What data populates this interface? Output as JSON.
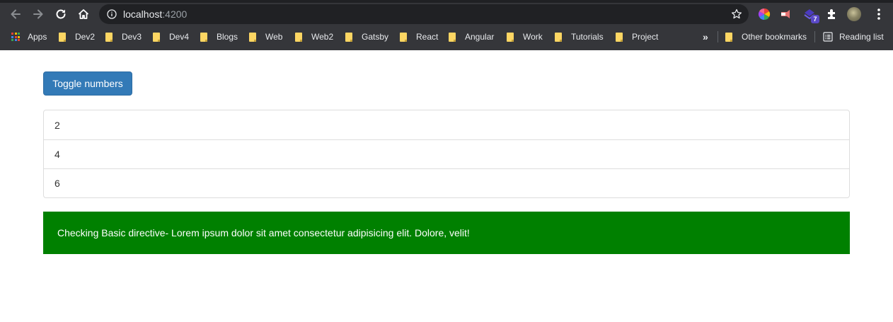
{
  "browser": {
    "url_host": "localhost",
    "url_port": ":4200",
    "extension_badge": "7",
    "bookmarks": [
      {
        "label": "Apps",
        "type": "apps"
      },
      {
        "label": "Dev2",
        "type": "folder"
      },
      {
        "label": "Dev3",
        "type": "folder"
      },
      {
        "label": "Dev4",
        "type": "folder"
      },
      {
        "label": "Blogs",
        "type": "folder"
      },
      {
        "label": "Web",
        "type": "folder"
      },
      {
        "label": "Web2",
        "type": "folder"
      },
      {
        "label": "Gatsby",
        "type": "folder"
      },
      {
        "label": "React",
        "type": "folder"
      },
      {
        "label": "Angular",
        "type": "folder"
      },
      {
        "label": "Work",
        "type": "folder"
      },
      {
        "label": "Tutorials",
        "type": "folder"
      },
      {
        "label": "Project",
        "type": "folder"
      }
    ],
    "more_bookmarks": "»",
    "other_bookmarks": "Other bookmarks",
    "reading_list": "Reading list"
  },
  "page": {
    "toggle_button": "Toggle numbers",
    "numbers": [
      "2",
      "4",
      "6"
    ],
    "directive_text": "Checking Basic directive- Lorem ipsum dolor sit amet consectetur adipisicing elit. Dolore, velit!"
  },
  "colors": {
    "chrome_bg": "#35363a",
    "omnibox_bg": "#202124",
    "button_primary": "#337ab7",
    "highlight_bg": "#008000"
  }
}
